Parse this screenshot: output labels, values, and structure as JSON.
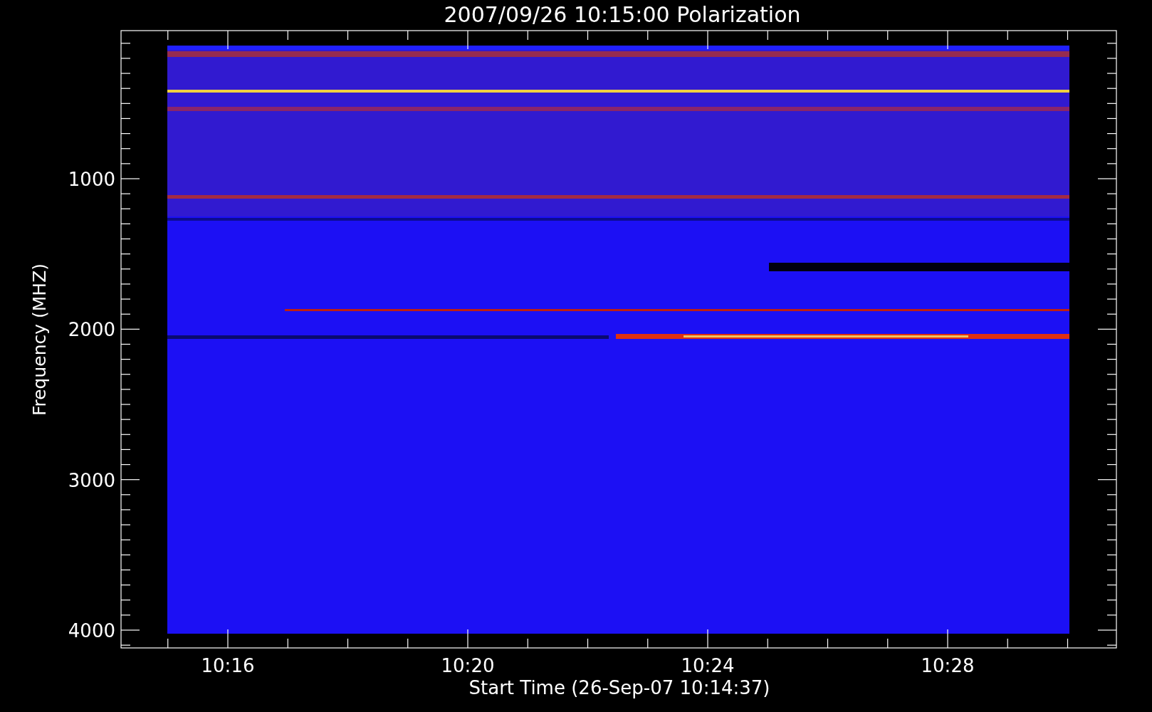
{
  "title": "2007/09/26 10:15:00 Polarization",
  "y_axis": {
    "label": "Frequency (MHZ)",
    "ticks": [
      "1000",
      "2000",
      "3000",
      "4000"
    ]
  },
  "x_axis": {
    "label": "Start Time (26-Sep-07 10:14:37)",
    "ticks": [
      "10:16",
      "10:20",
      "10:24",
      "10:28"
    ]
  }
}
